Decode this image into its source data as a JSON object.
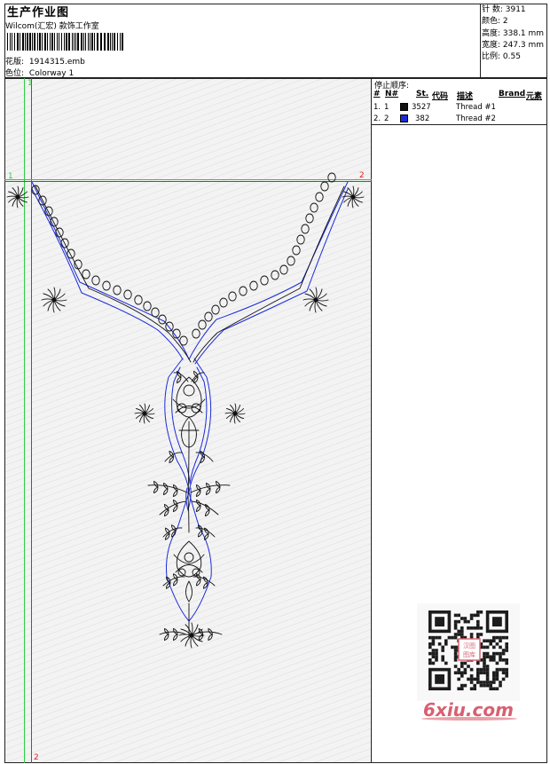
{
  "header": {
    "title": "生产作业图",
    "company": "Wilcom(汇宏) 款饰工作室",
    "design_label": "花版:",
    "design_value": "1914315.emb",
    "colorway_label": "色位:",
    "colorway_value": "Colorway 1"
  },
  "stats": {
    "stitches": "针 数: 3911",
    "colors": "颜色: 2",
    "height": "高度: 338.1 mm",
    "width": "宽度: 247.3 mm",
    "scale": "比例: 0.55"
  },
  "stop_sequence": {
    "title": "停止顺序:",
    "columns": [
      "#",
      "N#",
      "St.",
      "代码",
      "描述",
      "Brand",
      "元素"
    ],
    "rows": [
      {
        "index": "1.",
        "n": "1",
        "color": "#111111",
        "code": "3527",
        "desc": "Thread #1"
      },
      {
        "index": "2.",
        "n": "2",
        "color": "#1a2cd8",
        "code": "382",
        "desc": "Thread #2"
      }
    ]
  },
  "guides": {
    "top_left": "1",
    "top_right": "2",
    "left_top": "1",
    "left_bottom": "2"
  },
  "colors": {
    "thread1": "#111111",
    "thread2": "#1a2cd8",
    "guide_green": "#2ecc40",
    "guide_red": "#e02020"
  },
  "watermark": {
    "text": "6xiu.com",
    "qr_badge": "汉图 图库"
  }
}
